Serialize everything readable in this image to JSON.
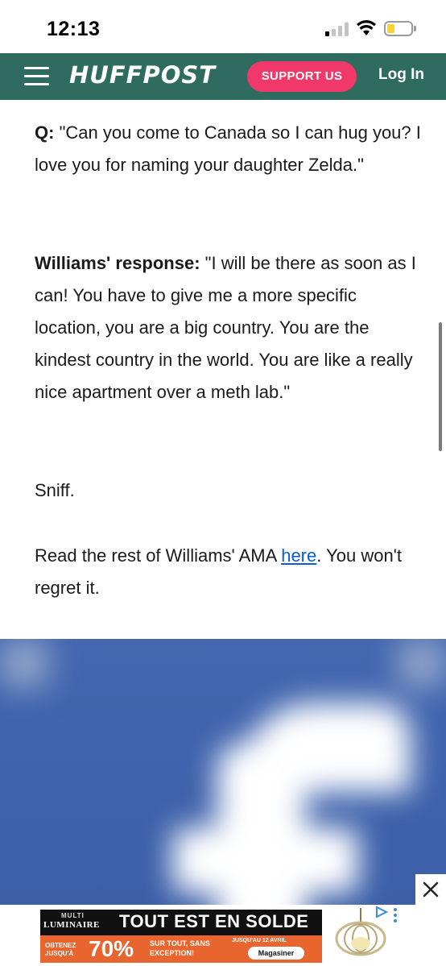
{
  "status_bar": {
    "time": "12:13",
    "battery_level": 0.2,
    "signal_bars_active": 1
  },
  "header": {
    "logo": "HUFFPOST",
    "support_label": "SUPPORT US",
    "login_label": "Log In",
    "background_color": "#2f6b5e",
    "accent_color": "#f0386b"
  },
  "article": {
    "q_label": "Q:",
    "q_text": " \"Can you come to Canada so I can hug you? I love you for naming your daughter Zelda.\"",
    "response_label": "Williams' response:",
    "response_text": " \"I will be there as soon as I can! You have to give me a more specific location, you are a big country. You are the kindest country in the world. You are like a really nice apartment over a meth lab.\"",
    "sniff": "Sniff.",
    "read_prefix": "Read the rest of Williams' AMA ",
    "read_link": "here",
    "read_suffix": ". You won't regret it."
  },
  "ad": {
    "brand_small": "MULTI",
    "brand": "LUMINAIRE",
    "headline": "TOUT EST EN SOLDE",
    "obtenez": "OBTENEZ JUSQU'À",
    "percent": "70%",
    "sur_tout": "SUR TOUT, SANS EXCEPTION!",
    "until": "JUSQU'AU 12 AVRIL",
    "shop_label": "Magasiner",
    "close_icon": "close-icon"
  }
}
